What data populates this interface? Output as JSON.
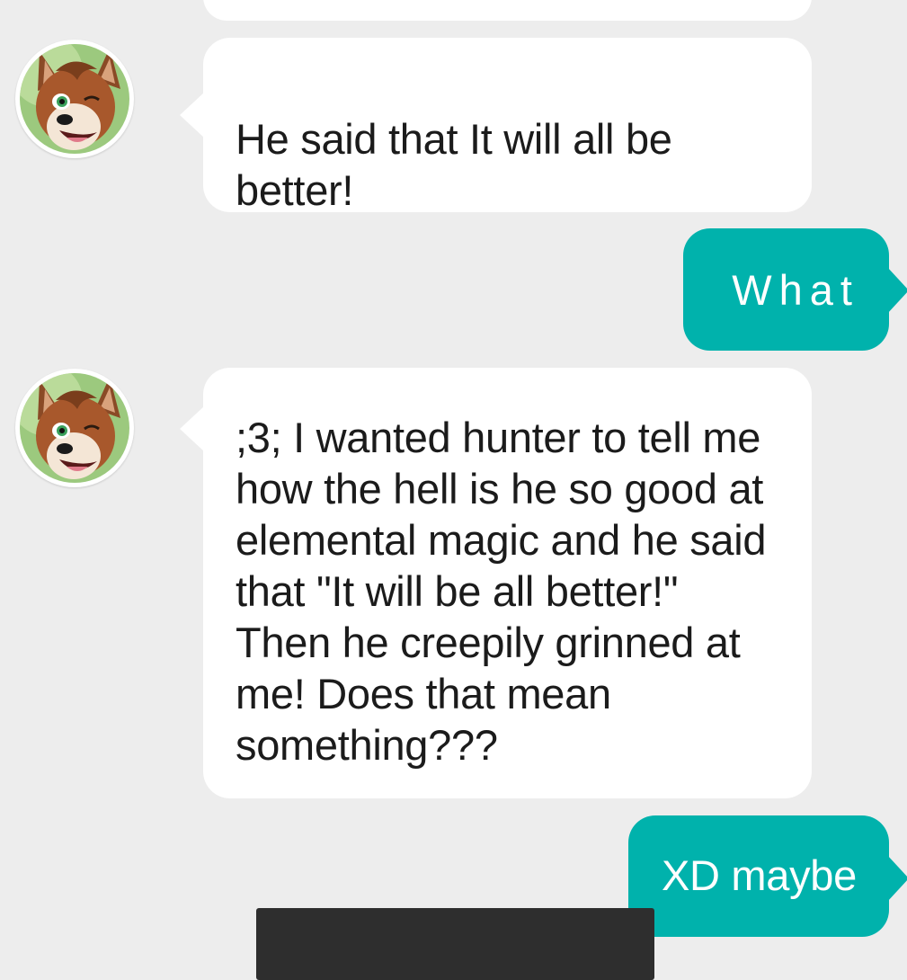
{
  "conversation": {
    "messages": [
      {
        "direction": "incoming",
        "text": "He said that It will all be better!",
        "avatar_icon": "fox-avatar-icon"
      },
      {
        "direction": "outgoing",
        "text": "What"
      },
      {
        "direction": "incoming",
        "text": ";3; I wanted hunter to tell me how the hell is he so good at elemental magic and he said that \"It will be all better!\" Then he creepily grinned at me! Does that mean something???",
        "avatar_icon": "fox-avatar-icon"
      },
      {
        "direction": "outgoing",
        "text": "XD maybe"
      }
    ]
  },
  "toast": {
    "label": ""
  },
  "colors": {
    "background": "#ededed",
    "incoming_bubble": "#ffffff",
    "outgoing_bubble": "#00b2ac",
    "outgoing_text": "#ffffff",
    "text": "#1b1b1b",
    "toast_background": "#2e2e2e"
  }
}
